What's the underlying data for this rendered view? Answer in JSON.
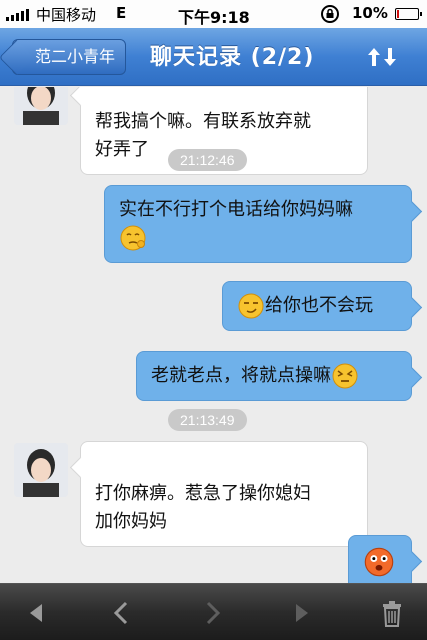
{
  "status": {
    "carrier": "中国移动",
    "network": "E",
    "time": "下午9:18",
    "battery": "10%",
    "battery_level": 0.1
  },
  "nav": {
    "back_label": "范二小青年",
    "title": "聊天记录 (2/2)",
    "sort_icon": "sort-arrows-icon"
  },
  "messages": [
    {
      "side": "left",
      "text": "帮我搞个嘛。有联系放弃就\n好弄了"
    },
    {
      "type": "timestamp",
      "text": "21:12:46"
    },
    {
      "side": "right",
      "text": "实在不行打个电话给你妈妈嘛",
      "emoji": "thinking-face-emoji"
    },
    {
      "side": "right",
      "text": "给你也不会玩",
      "emoji": "smirk-face-emoji"
    },
    {
      "side": "right",
      "text": "老就老点，将就点操嘛",
      "emoji": "squinting-face-emoji"
    },
    {
      "type": "timestamp",
      "text": "21:13:49"
    },
    {
      "side": "left",
      "text": "打你麻痹。惹急了操你媳妇\n加你妈妈"
    },
    {
      "side": "right",
      "emoji": "shocked-face-emoji"
    }
  ],
  "toolbar": {
    "items": [
      "first-page-icon",
      "prev-page-icon",
      "next-page-icon",
      "last-page-icon",
      "trash-icon"
    ]
  },
  "colors": {
    "nav_blue": "#3f80d3",
    "bubble_right": "#6fb1ea",
    "bubble_left": "#ffffff",
    "background": "#ececec"
  }
}
